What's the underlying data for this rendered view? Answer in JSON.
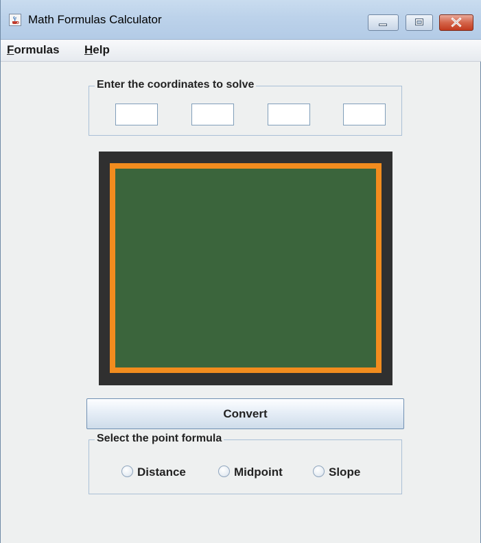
{
  "window": {
    "title": "Math Formulas Calculator"
  },
  "menu": {
    "formulas": {
      "mnemonic": "F",
      "rest": "ormulas"
    },
    "help": {
      "mnemonic": "H",
      "rest": "elp"
    }
  },
  "coordinates": {
    "group_title": "Enter the coordinates to solve",
    "inputs": [
      {
        "value": ""
      },
      {
        "value": ""
      },
      {
        "value": ""
      },
      {
        "value": ""
      }
    ]
  },
  "chalkboard": {
    "text": "",
    "colors": {
      "outer": "#303030",
      "frame": "#f28c1e",
      "board": "#3b653c"
    }
  },
  "convert_button": {
    "label": "Convert"
  },
  "formula_selector": {
    "group_title": "Select the point formula",
    "options": [
      {
        "label": "Distance",
        "selected": false
      },
      {
        "label": "Midpoint",
        "selected": false
      },
      {
        "label": "Slope",
        "selected": false
      }
    ]
  },
  "icons": {
    "app": "java-coffee-icon",
    "minimize": "minimize-icon",
    "maximize": "maximize-icon",
    "close": "close-icon"
  }
}
